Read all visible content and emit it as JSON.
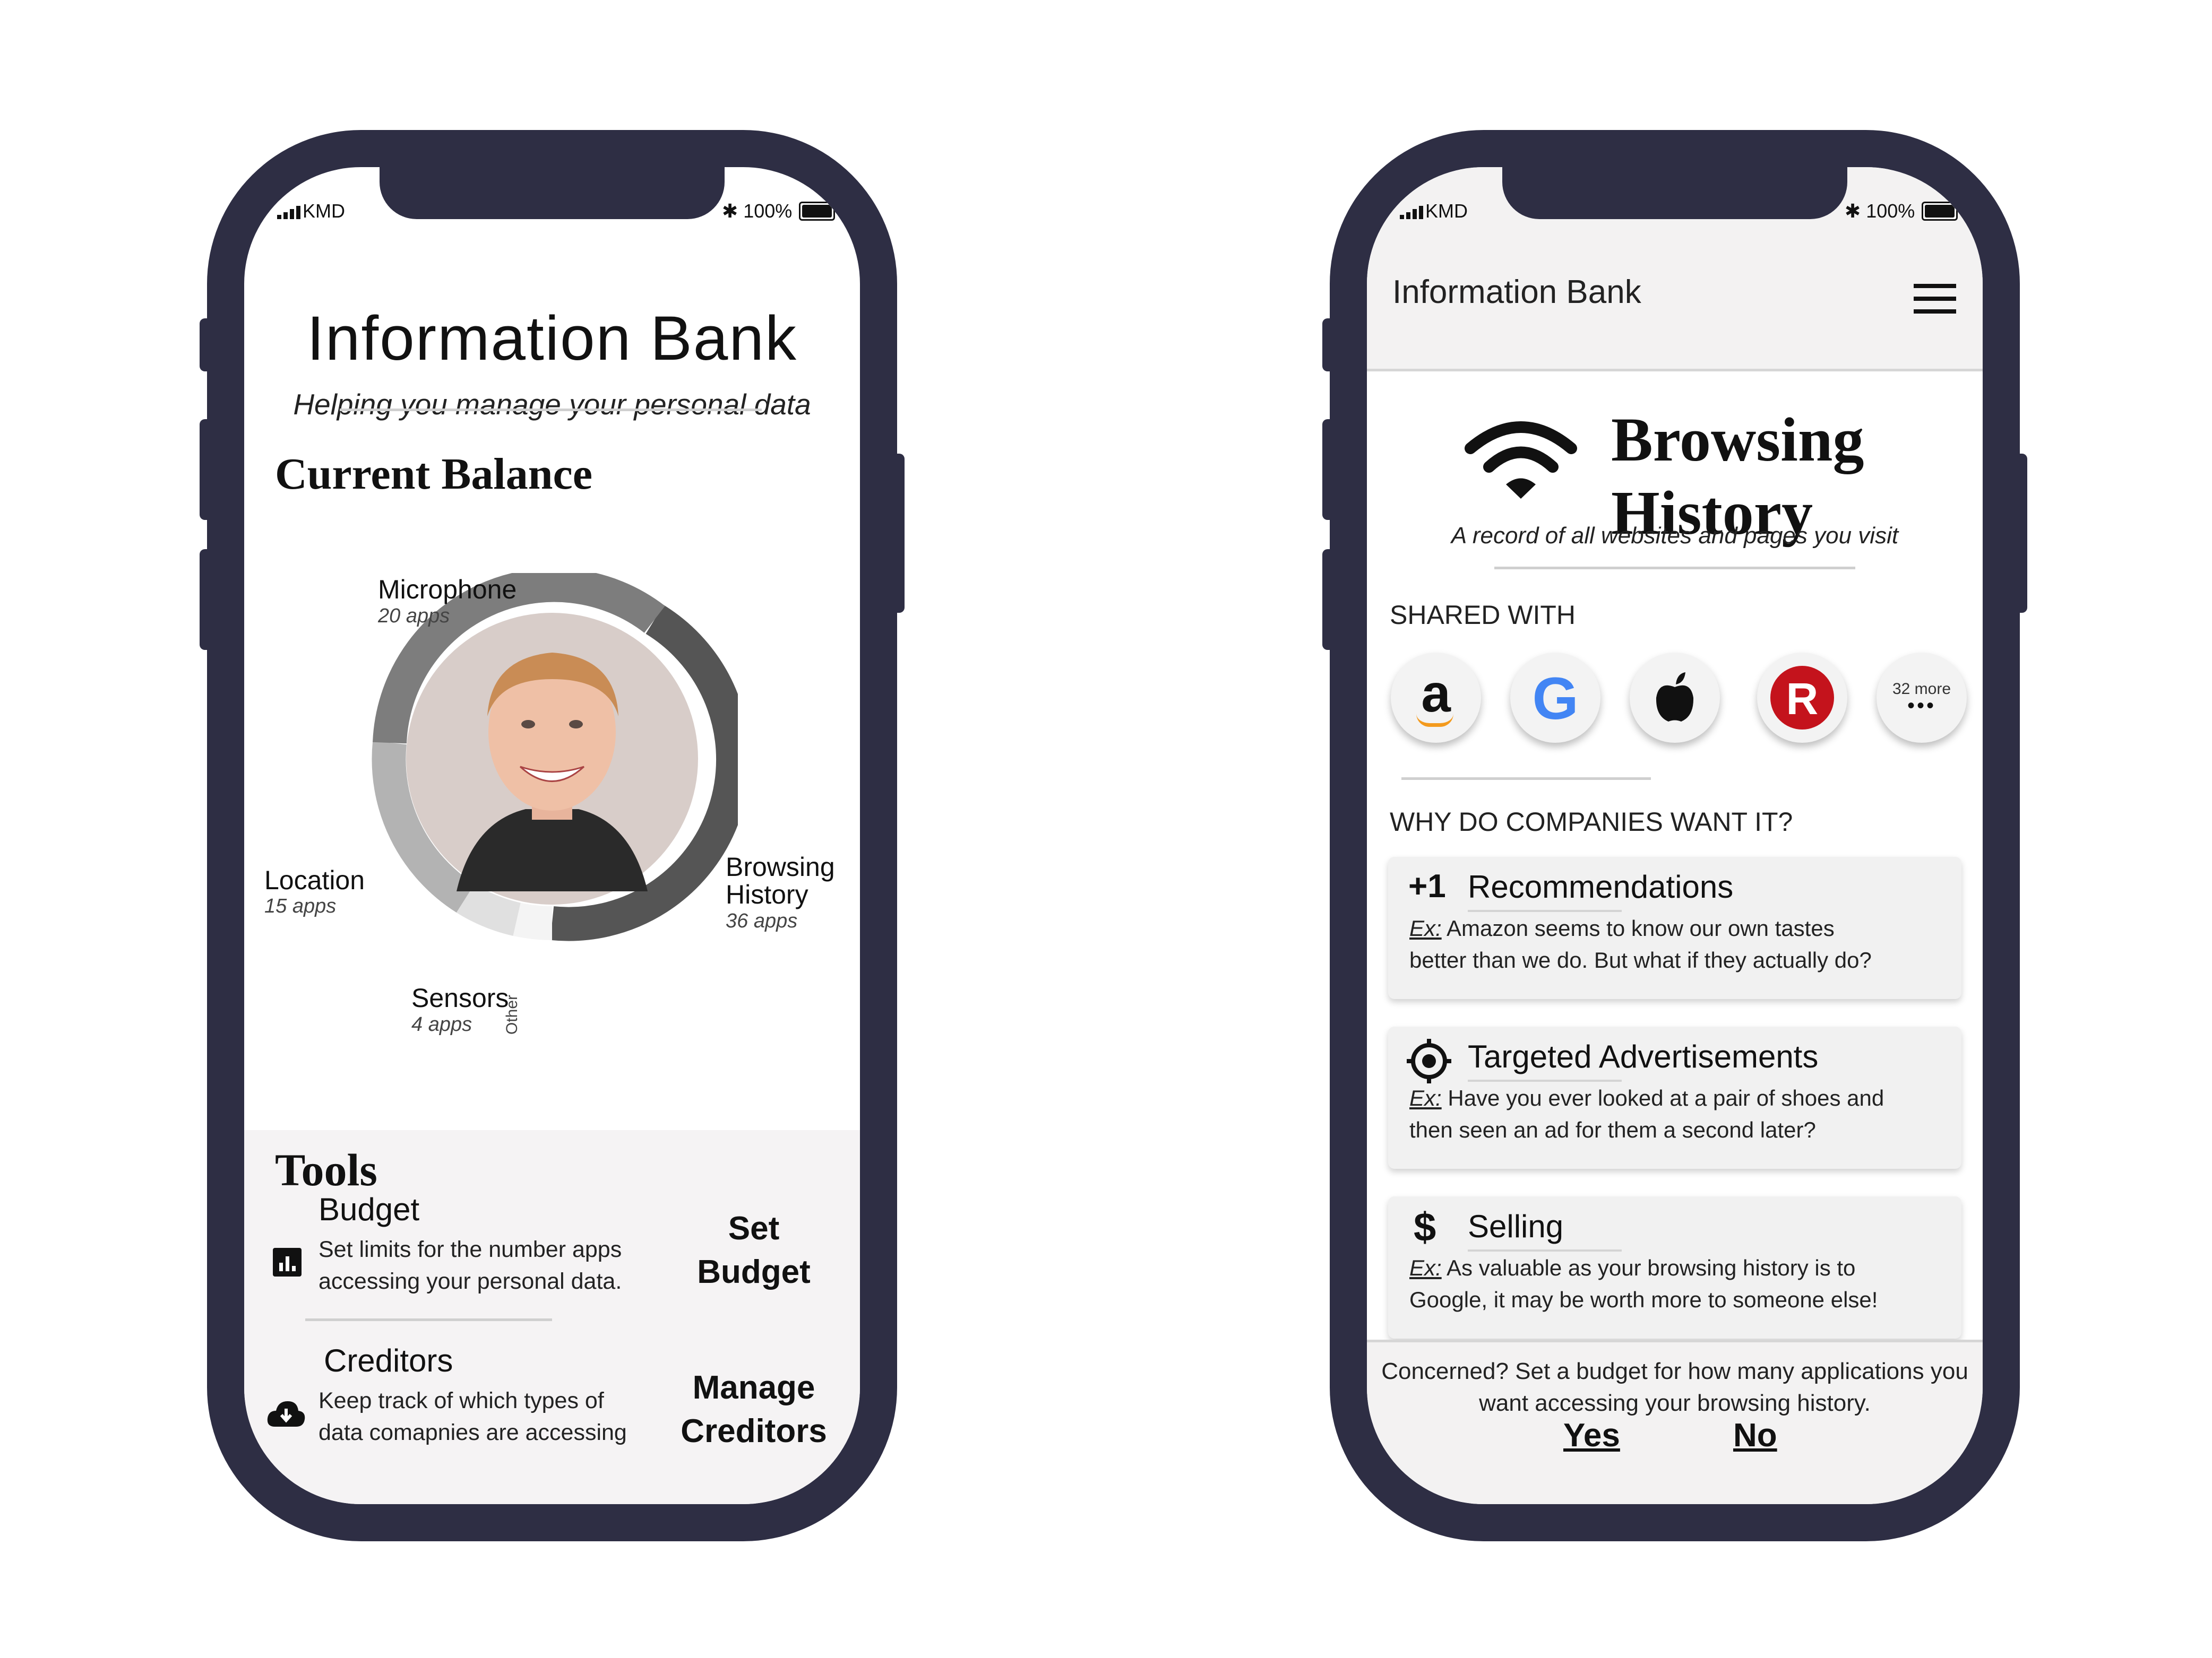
{
  "left_phone": {
    "status": {
      "carrier": "KMD",
      "battery": "100%"
    },
    "header": {
      "title": "Information Bank",
      "subtitle": "Helping you manage your personal data"
    },
    "balance": {
      "heading": "Current Balance",
      "segments": [
        {
          "label": "Microphone",
          "sub": "20 apps"
        },
        {
          "label": "Location",
          "sub": "15 apps"
        },
        {
          "label": "Browsing History",
          "line1": "Browsing",
          "line2": "History",
          "sub": "36 apps"
        },
        {
          "label": "Sensors",
          "sub": "4 apps"
        },
        {
          "label": "Other"
        }
      ]
    },
    "tools": {
      "heading": "Tools",
      "items": [
        {
          "title": "Budget",
          "desc1": "Set limits for the number apps",
          "desc2": "accessing your personal data.",
          "action1": "Set",
          "action2": "Budget",
          "icon": "bar-chart-icon"
        },
        {
          "title": "Creditors",
          "desc1": "Keep track of which types of",
          "desc2": "data comapnies are accessing",
          "action1": "Manage",
          "action2": "Creditors",
          "icon": "cloud-download-icon"
        }
      ]
    }
  },
  "right_phone": {
    "status": {
      "carrier": "KMD",
      "battery": "100%"
    },
    "appbar": {
      "title": "Information Bank",
      "menu_icon": "hamburger-menu-icon"
    },
    "hero": {
      "title1": "Browsing",
      "title2": "History",
      "subtitle": "A record of all websites and pages you visit",
      "icon": "wifi-icon"
    },
    "shared": {
      "heading": "SHARED WITH",
      "companies": [
        {
          "icon": "amazon-logo-icon",
          "text": "a"
        },
        {
          "icon": "google-logo-icon",
          "text": "G"
        },
        {
          "icon": "apple-logo-icon",
          "text": ""
        },
        {
          "icon": "rakuten-logo-icon",
          "text": "R"
        },
        {
          "icon": "more-icon",
          "text": "32 more",
          "dots": "•••"
        }
      ]
    },
    "why": {
      "heading": "WHY DO COMPANIES WANT IT?",
      "cards": [
        {
          "icon_text": "+1",
          "title": "Recommendations",
          "ex": "Ex:",
          "line1": " Amazon seems to know our own tastes",
          "line2": "better than we do. But what if they actually do?"
        },
        {
          "icon_text": "",
          "title": "Targeted Advertisements",
          "ex": "Ex:",
          "line1": " Have you ever looked at a pair of shoes and",
          "line2": "then seen an ad for them a second later?"
        },
        {
          "icon_text": "$",
          "title": "Selling",
          "ex": "Ex:",
          "line1": " As valuable as your browsing history is to",
          "line2": "Google, it may be worth more to someone else!"
        }
      ]
    },
    "footer": {
      "line1": "Concerned? Set a budget for how many applications you",
      "line2": "want accessing your browsing history.",
      "yes": "Yes",
      "no": "No"
    }
  },
  "colors": {
    "frame": "#2e2e44",
    "ring_dark": "#555555",
    "ring_mid": "#7d7d7d",
    "ring_light": "#b3b3b3",
    "amazon_orange": "#f39a1e",
    "rakuten_red": "#c4131c"
  }
}
